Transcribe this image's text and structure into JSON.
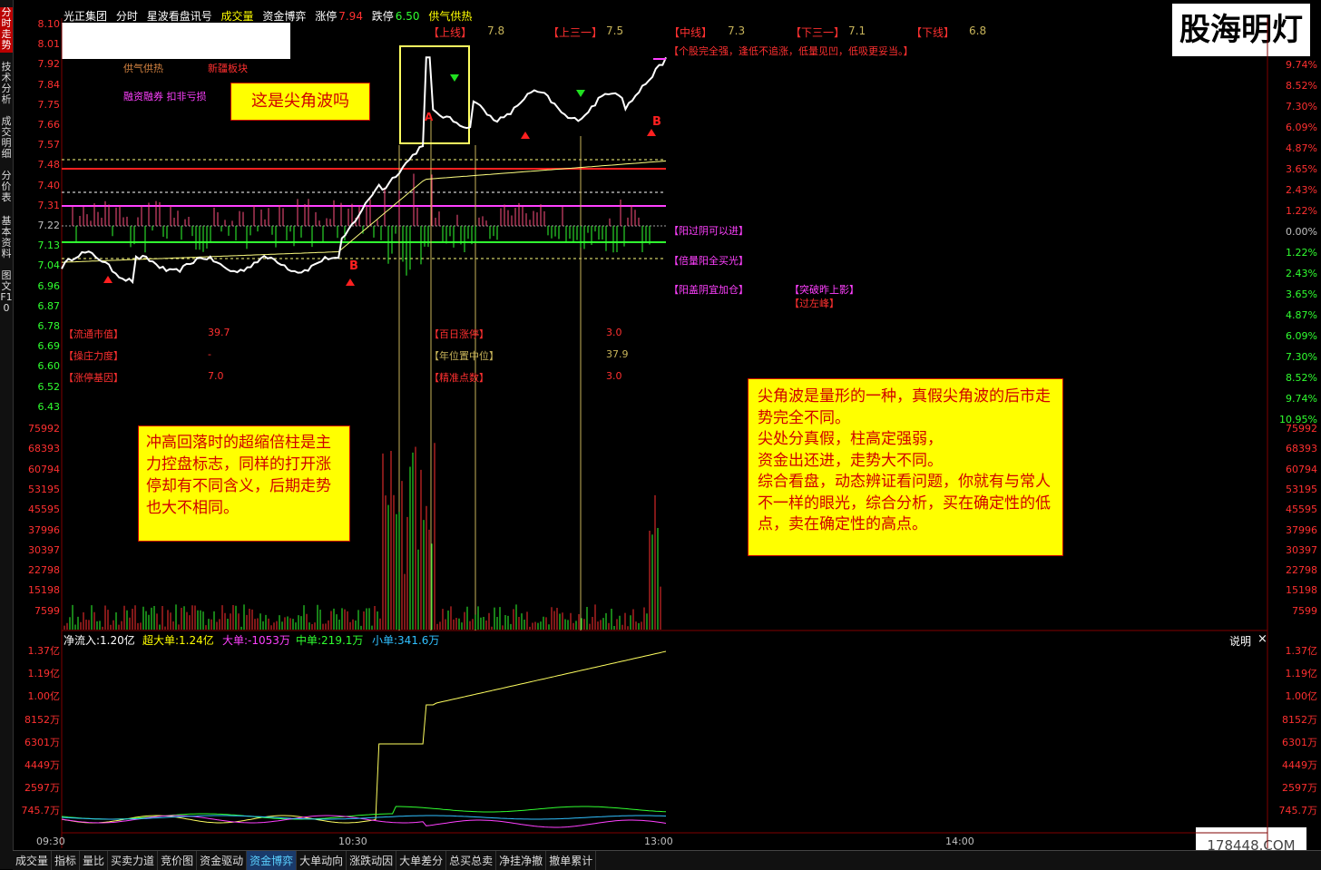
{
  "side_tabs": [
    {
      "label": "分时走势",
      "active": true
    },
    {
      "label": "技术分析",
      "active": false
    },
    {
      "label": "成交明细",
      "active": false
    },
    {
      "label": "分价表",
      "active": false
    },
    {
      "label": "基本资料",
      "active": false
    },
    {
      "label": "图文F10",
      "active": false
    }
  ],
  "toolbar": {
    "stock_name": "光正集团",
    "view": "分时",
    "indicator_name": "星波看盘讯号",
    "volume_label": "成交量",
    "fund_label": "资金博弈",
    "limit_up_label": "涨停",
    "limit_up_value": "7.94",
    "limit_down_label": "跌停",
    "limit_down_value": "6.50",
    "supply_label": "供气供热"
  },
  "watermark": "股海明灯",
  "site_watermark": "178448.COM",
  "price_axis_left": [
    "8.10",
    "8.01",
    "7.92",
    "7.84",
    "7.75",
    "7.66",
    "7.57",
    "7.48",
    "7.40",
    "7.31",
    "7.22",
    "7.13",
    "7.04",
    "6.96",
    "6.87",
    "6.78",
    "6.69",
    "6.60",
    "6.52",
    "6.43"
  ],
  "pct_axis_right": [
    "9.74%",
    "8.52%",
    "7.30%",
    "6.09%",
    "4.87%",
    "3.65%",
    "2.43%",
    "1.22%",
    "0.00%",
    "1.22%",
    "2.43%",
    "3.65%",
    "4.87%",
    "6.09%",
    "7.30%",
    "8.52%",
    "9.74%",
    "10.95%"
  ],
  "volume_axis": [
    "75992",
    "68393",
    "60794",
    "53195",
    "45595",
    "37996",
    "30397",
    "22798",
    "15198",
    "7599"
  ],
  "flow_axis": [
    "1.37亿",
    "1.19亿",
    "1.00亿",
    "8152万",
    "6301万",
    "4449万",
    "2597万",
    "745.7万"
  ],
  "time_axis": [
    "09:30",
    "10:30",
    "13:00",
    "14:00"
  ],
  "levels": [
    {
      "name": "【上线】",
      "value": "7.8"
    },
    {
      "name": "【上三一】",
      "value": "7.5"
    },
    {
      "name": "【中线】",
      "value": "7.3"
    },
    {
      "name": "【下三一】",
      "value": "7.1"
    },
    {
      "name": "【下线】",
      "value": "6.8"
    }
  ],
  "chart_tags": {
    "sector1": "供气供热",
    "sector2": "新疆板块",
    "margin_tag": "融资融券 扣非亏损",
    "warning": "【个股完全强，逢低不追涨，低量见凹，低吸更妥当。】",
    "sig1": "【阳过阴可以进】",
    "sig2": "【倍量阳全买光】",
    "sig3": "【阳盖阴宜加仓】",
    "sig4": "【突破昨上影】",
    "sig5": "【过左峰】"
  },
  "stats": [
    {
      "label": "【流通市值】",
      "value": "39.7"
    },
    {
      "label": "【操庄力度】",
      "value": "-"
    },
    {
      "label": "【涨停基因】",
      "value": "7.0"
    },
    {
      "label": "【百日涨停】",
      "value": "3.0"
    },
    {
      "label": "【年位置中位】",
      "value": "37.9"
    },
    {
      "label": "【精准点数】",
      "value": "3.0"
    }
  ],
  "notes": {
    "title_note": "这是尖角波吗",
    "left_note": "冲高回落时的超缩倍柱是主力控盘标志，同样的打开涨停却有不同含义，后期走势也大不相同。",
    "right_note": "尖角波是量形的一种，真假尖角波的后市走势完全不同。\n尖处分真假，柱高定强弱，\n资金出还进，走势大不同。\n综合看盘，动态辨证看问题，你就有与常人不一样的眼光，综合分析，买在确定性的低点，卖在确定性的高点。"
  },
  "flow_header": {
    "net": "净流入:1.20亿",
    "super": "超大单:1.24亿",
    "large": "大单:-1053万",
    "medium": "中单:219.1万",
    "small": "小单:341.6万",
    "explain": "说明",
    "close": "×"
  },
  "bottom_tabs": [
    "成交量",
    "指标",
    "量比",
    "买卖力道",
    "竞价图",
    "资金驱动",
    "资金博弈",
    "大单动向",
    "涨跌动因",
    "大单差分",
    "总买总卖",
    "净挂净撤",
    "撤单累计"
  ],
  "active_bottom_tab": "资金博弈",
  "colors": {
    "up": "#ff3030",
    "down": "#30ff30",
    "price": "#ffffff",
    "avg": "#ffff80",
    "magenta": "#ff40ff"
  },
  "chart_data": {
    "type": "line",
    "x": [
      "09:30",
      "10:00",
      "10:30",
      "11:00",
      "11:30",
      "13:00"
    ],
    "series": [
      {
        "name": "price",
        "values": [
          7.04,
          7.02,
          7.15,
          7.6,
          7.73,
          7.92
        ]
      },
      {
        "name": "avg",
        "values": [
          7.04,
          7.08,
          7.14,
          7.4,
          7.43,
          7.47
        ]
      }
    ],
    "ylim": [
      6.43,
      8.1
    ],
    "prev_close": 7.22
  }
}
